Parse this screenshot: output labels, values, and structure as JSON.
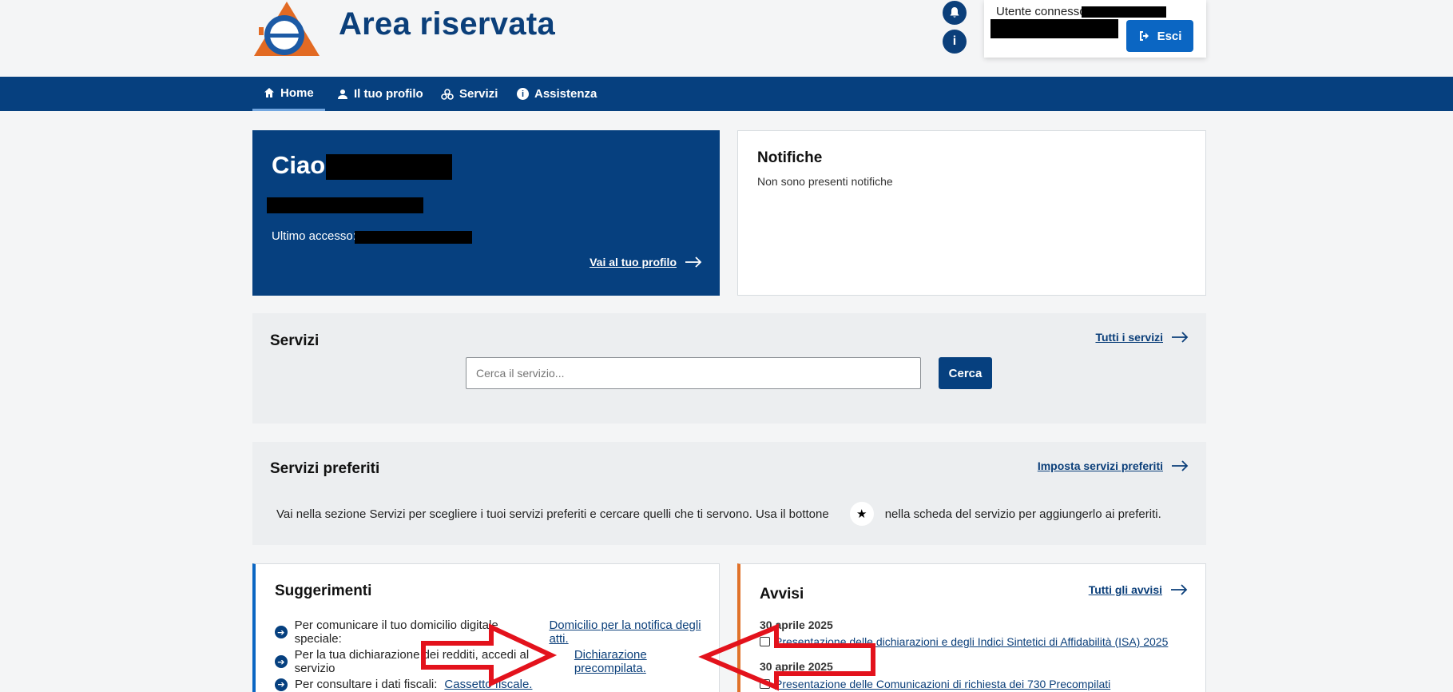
{
  "header": {
    "app_title": "Area riservata",
    "user_label": "Utente connesso:",
    "logout_label": "Esci"
  },
  "nav": {
    "items": [
      {
        "label": "Home",
        "icon": "home-icon",
        "active": true
      },
      {
        "label": "Il tuo profilo",
        "icon": "user-icon"
      },
      {
        "label": "Servizi",
        "icon": "services-icon"
      },
      {
        "label": "Assistenza",
        "icon": "info-icon"
      }
    ]
  },
  "greeting": {
    "hello": "Ciao,",
    "last_access_label": "Ultimo accesso:",
    "profile_link": "Vai al tuo profilo"
  },
  "notifications": {
    "title": "Notifiche",
    "empty_text": "Non sono presenti notifiche"
  },
  "services": {
    "title": "Servizi",
    "all_link": "Tutti i servizi",
    "search_placeholder": "Cerca il servizio...",
    "search_button": "Cerca"
  },
  "favorites": {
    "title": "Servizi preferiti",
    "set_link": "Imposta servizi preferiti",
    "text_before": "Vai nella sezione Servizi per scegliere i tuoi servizi preferiti e cercare quelli che ti servono. Usa il bottone",
    "text_after": "nella scheda del servizio per aggiungerlo ai preferiti."
  },
  "suggestions": {
    "title": "Suggerimenti",
    "items": [
      {
        "text": "Per comunicare il tuo domicilio digitale speciale:",
        "link": "Domicilio per la notifica degli atti."
      },
      {
        "text": "Per la tua dichiarazione dei redditi, accedi al servizio",
        "link": "Dichiarazione precompilata."
      },
      {
        "text": "Per consultare i dati fiscali:",
        "link": "Cassetto fiscale."
      }
    ]
  },
  "notices": {
    "title": "Avvisi",
    "all_link": "Tutti gli avvisi",
    "items": [
      {
        "date": "30 aprile 2025",
        "text": "Presentazione delle dichiarazioni e degli Indici Sintetici di Affidabilità (ISA) 2025"
      },
      {
        "date": "30 aprile 2025",
        "text": "Presentazione delle Comunicazioni di richiesta dei 730 Precompilati"
      }
    ]
  },
  "colors": {
    "brand_blue": "#06407f",
    "button_blue": "#0b66c3",
    "annotation_red": "#e3121c"
  }
}
